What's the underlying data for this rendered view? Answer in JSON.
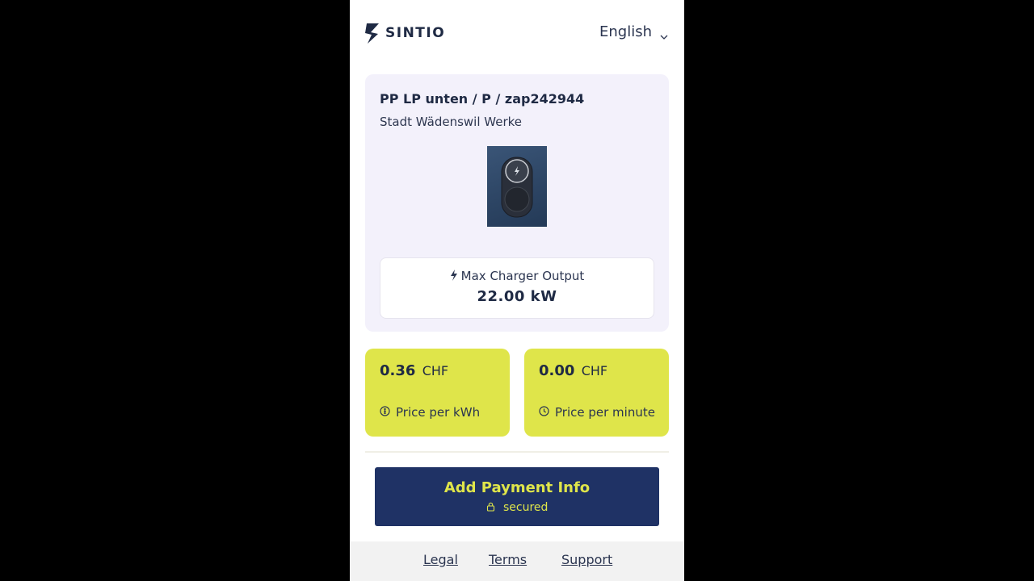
{
  "brand": {
    "name": "SINTIO",
    "logo_icon": "sintio-logo-icon",
    "color": "#1f2a44"
  },
  "language": {
    "selected": "English",
    "icon": "chevron-down-icon"
  },
  "station": {
    "title": "PP LP unten / P / zap242944",
    "operator": "Stadt Wädenswil Werke",
    "image_icon": "charger-image",
    "output_label": "Max Charger Output",
    "output_icon": "bolt-icon",
    "output_value": "22.00 kW"
  },
  "prices": [
    {
      "amount": "0.36",
      "currency": "CHF",
      "label": "Price per kWh",
      "icon": "coin-icon"
    },
    {
      "amount": "0.00",
      "currency": "CHF",
      "label": "Price per minute",
      "icon": "clock-icon"
    }
  ],
  "payment": {
    "label": "Add Payment Info",
    "sub": "secured",
    "icon": "lock-icon"
  },
  "footer": {
    "links": [
      "Legal",
      "Terms",
      "Support"
    ]
  },
  "colors": {
    "accent": "#dfe54a",
    "primary": "#1f3265",
    "card_bg": "#f3f1fb",
    "background": "#000000"
  }
}
